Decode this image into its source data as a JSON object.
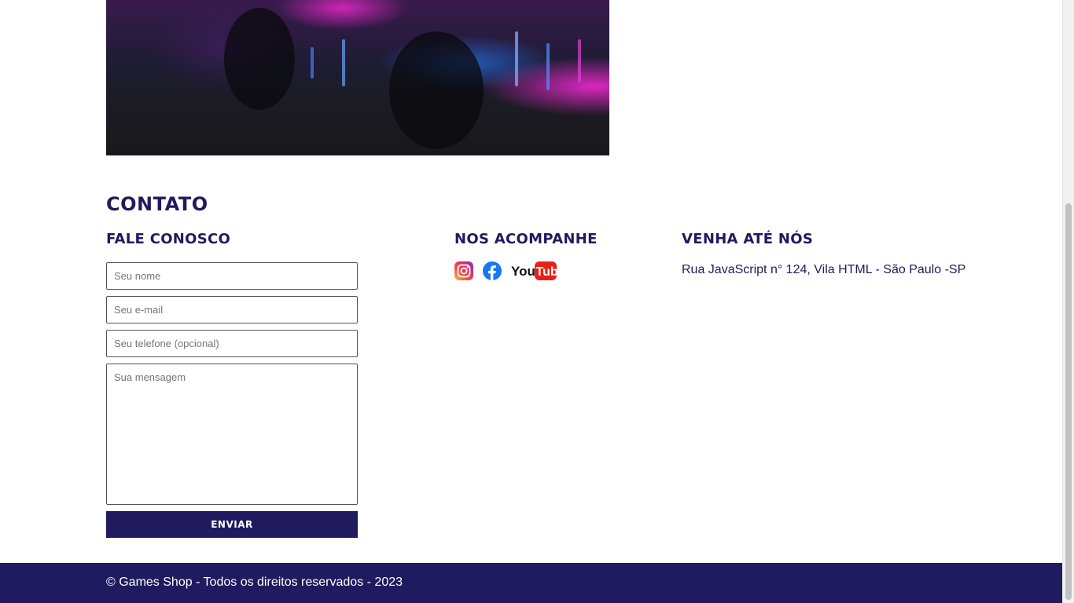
{
  "contact": {
    "section_title": "Contato",
    "form": {
      "title": "Fale conosco",
      "name_placeholder": "Seu nome",
      "email_placeholder": "Seu e-mail",
      "phone_placeholder": "Seu telefone (opcional)",
      "message_placeholder": "Sua mensagem",
      "submit_label": "Enviar"
    },
    "social": {
      "title": "Nos acompanhe",
      "icons": [
        "instagram-icon",
        "facebook-icon",
        "youtube-icon"
      ]
    },
    "address": {
      "title": "Venha até nós",
      "text": "Rua JavaScript n° 124, Vila HTML - São Paulo -SP"
    }
  },
  "footer": {
    "copyright": "© Games Shop - Todos os direitos reservados - 2023"
  },
  "colors": {
    "brand_navy": "#1f1b5e",
    "white": "#ffffff"
  }
}
